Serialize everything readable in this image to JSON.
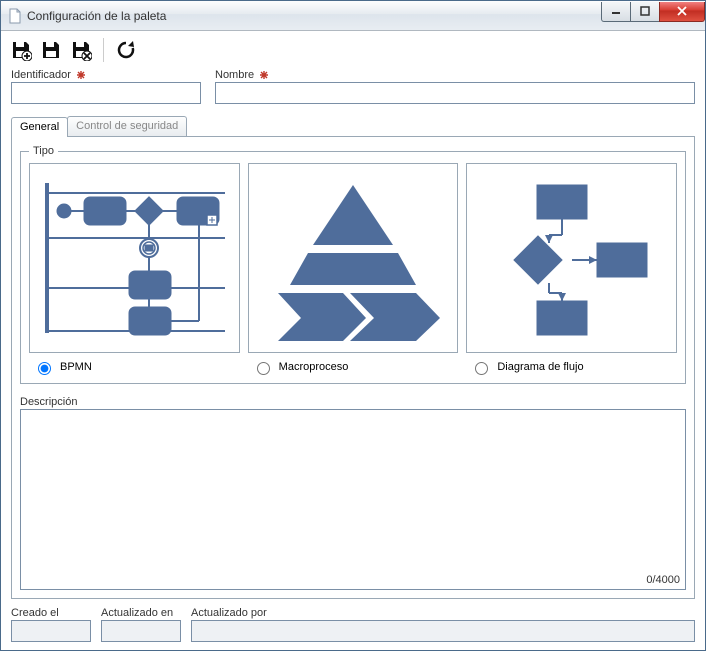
{
  "window": {
    "title": "Configuración de la paleta"
  },
  "toolbar": {
    "save_add_tip": "Guardar y nuevo",
    "save_tip": "Guardar",
    "save_close_tip": "Guardar y cerrar",
    "refresh_tip": "Actualizar"
  },
  "fields": {
    "identificador_label": "Identificador",
    "identificador_value": "",
    "nombre_label": "Nombre",
    "nombre_value": ""
  },
  "tabs": {
    "general": "General",
    "seguridad": "Control de seguridad"
  },
  "tipo": {
    "legend": "Tipo",
    "options": {
      "bpmn": "BPMN",
      "macro": "Macroproceso",
      "flujo": "Diagrama de flujo"
    },
    "selected": "bpmn"
  },
  "descripcion": {
    "label": "Descripción",
    "value": "",
    "counter": "0/4000"
  },
  "footer": {
    "creado_label": "Creado el",
    "creado_value": "",
    "actualizado_en_label": "Actualizado en",
    "actualizado_en_value": "",
    "actualizado_por_label": "Actualizado por",
    "actualizado_por_value": ""
  },
  "colors": {
    "accent": "#4f6d9b"
  }
}
